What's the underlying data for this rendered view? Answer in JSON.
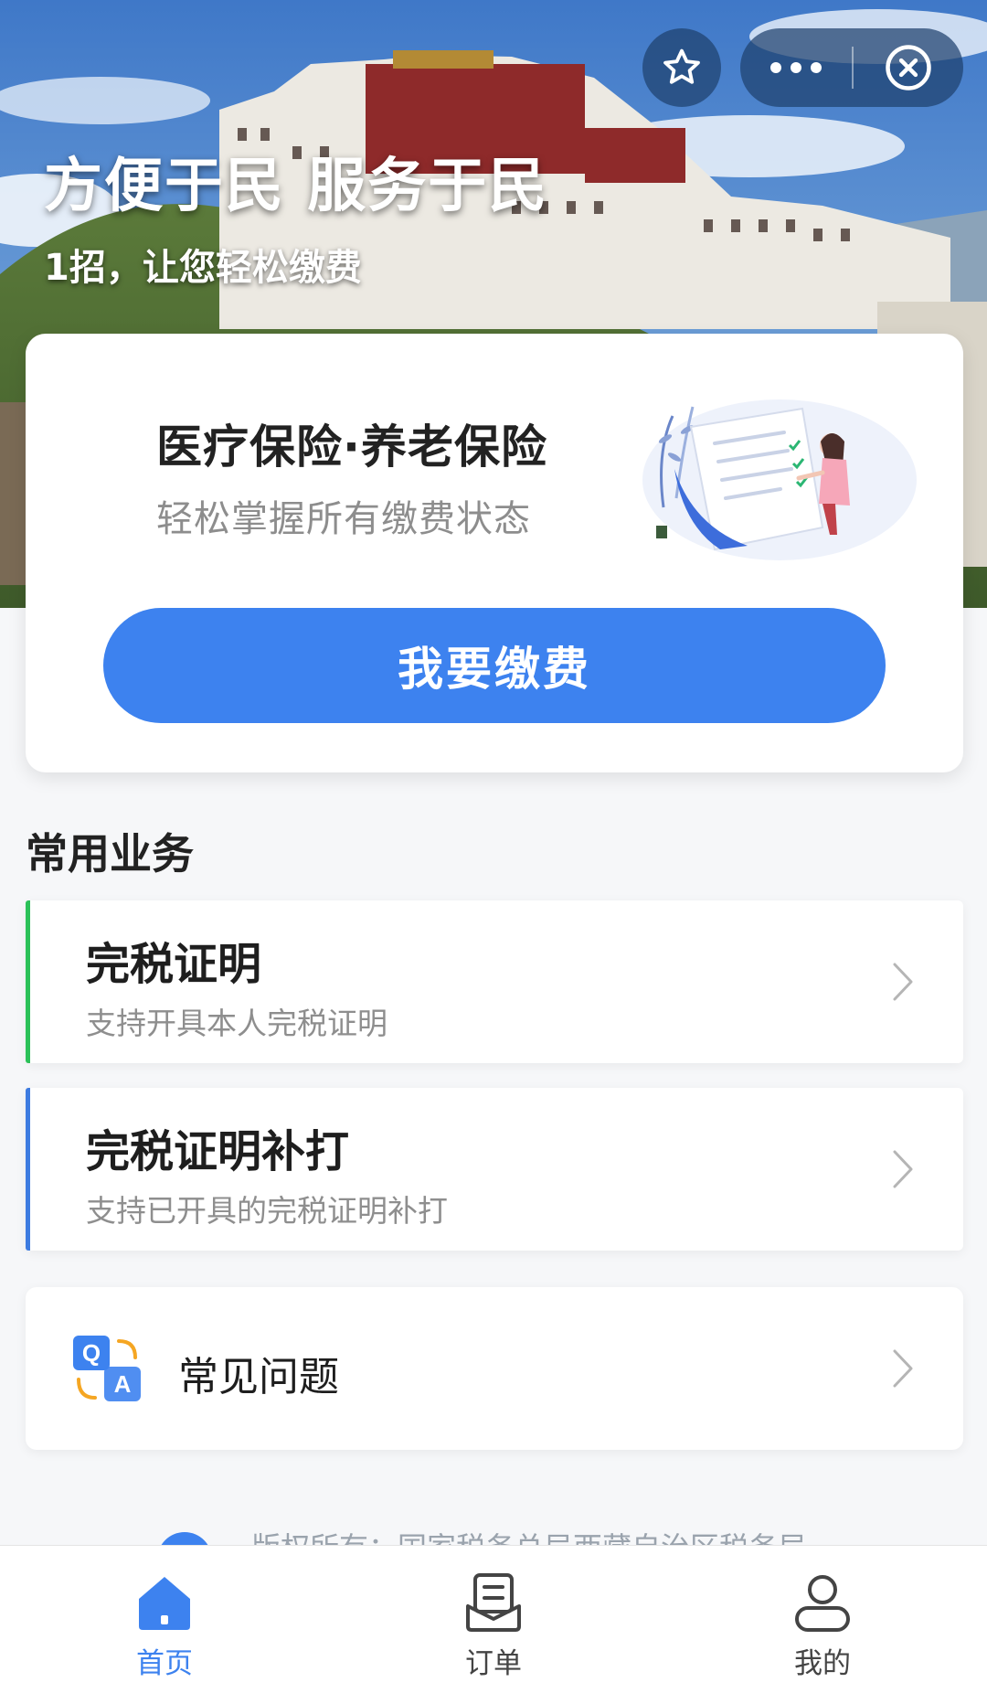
{
  "hero": {
    "title": "方便于民 服务于民",
    "subtitle": "1招，让您轻松缴费"
  },
  "capsule": {
    "star_icon": "star-icon",
    "more_icon": "more-dots-icon",
    "close_icon": "close-circle-icon"
  },
  "main_card": {
    "title": "医疗保险·养老保险",
    "subtitle": "轻松掌握所有缴费状态",
    "pay_button": "我要缴费"
  },
  "section": {
    "title": "常用业务",
    "items": [
      {
        "title": "完税证明",
        "subtitle": "支持开具本人完税证明",
        "accent": "#2bc158"
      },
      {
        "title": "完税证明补打",
        "subtitle": "支持已开具的完税证明补打",
        "accent": "#3d7be0"
      }
    ]
  },
  "faq": {
    "label": "常见问题",
    "icon": "qa-icon"
  },
  "footer": {
    "copyright": "版权所有：国家税务总局西藏自治区税务局"
  },
  "tabbar": {
    "tabs": [
      {
        "label": "首页",
        "icon": "home-icon",
        "active": true
      },
      {
        "label": "订单",
        "icon": "order-icon",
        "active": false
      },
      {
        "label": "我的",
        "icon": "user-icon",
        "active": false
      }
    ]
  },
  "colors": {
    "primary": "#3d82ef",
    "green_accent": "#2bc158",
    "blue_accent": "#3d7be0"
  }
}
